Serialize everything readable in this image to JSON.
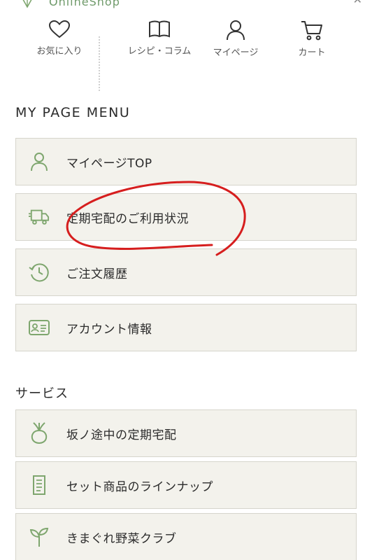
{
  "header": {
    "logo_text": "OnlineShop"
  },
  "nav": [
    {
      "label": "お気に入り",
      "icon": "heart-icon"
    },
    {
      "label": "レシピ・コラム",
      "icon": "book-icon"
    },
    {
      "label": "マイページ",
      "icon": "person-icon"
    },
    {
      "label": "カート",
      "icon": "cart-icon"
    }
  ],
  "mypage_menu": {
    "title": "MY PAGE MENU",
    "items": [
      {
        "label": "マイページTOP",
        "icon": "person-icon"
      },
      {
        "label": "定期宅配のご利用状況",
        "icon": "truck-icon"
      },
      {
        "label": "ご注文履歴",
        "icon": "history-icon"
      },
      {
        "label": "アカウント情報",
        "icon": "id-card-icon"
      }
    ]
  },
  "services": {
    "title": "サービス",
    "items": [
      {
        "label": "坂ノ途中の定期宅配",
        "icon": "turnip-icon"
      },
      {
        "label": "セット商品のラインナップ",
        "icon": "document-icon"
      },
      {
        "label": "きまぐれ野菜クラブ",
        "icon": "sprout-icon"
      }
    ]
  },
  "colors": {
    "accent": "#7ea66e",
    "button_bg": "#f3f2ec",
    "button_border": "#d6d5cc",
    "annotation": "#d61e1e"
  }
}
